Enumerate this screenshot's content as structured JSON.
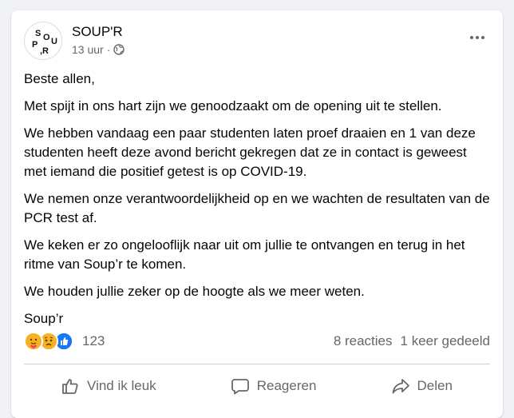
{
  "post": {
    "author": "SOUP'R",
    "time": "13 uur",
    "separator": "·",
    "avatar_letters": [
      "S",
      "O",
      "U",
      "P",
      ",R"
    ],
    "paragraphs": [
      "Beste allen,",
      "Met spijt in ons hart zijn we genoodzaakt om de opening uit te stellen.",
      "We hebben vandaag een paar studenten laten proef draaien en 1 van deze studenten heeft deze avond bericht gekregen dat ze in contact is geweest met iemand die positief getest is op COVID-19.",
      "We nemen onze verantwoordelijkheid op en we wachten de resultaten van de PCR test af.",
      "We keken er zo ongelooflijk naar uit om jullie te ontvangen en terug in het ritme van Soup’r te komen.",
      "We houden jullie zeker op de hoogte als we meer weten.",
      "Soup’r"
    ]
  },
  "stats": {
    "reaction_icons": [
      "care-reaction-icon",
      "sad-reaction-icon",
      "like-reaction-icon"
    ],
    "reaction_count": "123",
    "comments": "8 reacties",
    "shares": "1 keer gedeeld"
  },
  "actions": {
    "like": "Vind ik leuk",
    "comment": "Reageren",
    "share": "Delen"
  },
  "colors": {
    "background": "#f0f2f5",
    "card": "#ffffff",
    "secondary_text": "#65676b",
    "like_blue": "#1877f2",
    "reaction_yellow": "#f7b125",
    "care_red": "#f33e58"
  }
}
